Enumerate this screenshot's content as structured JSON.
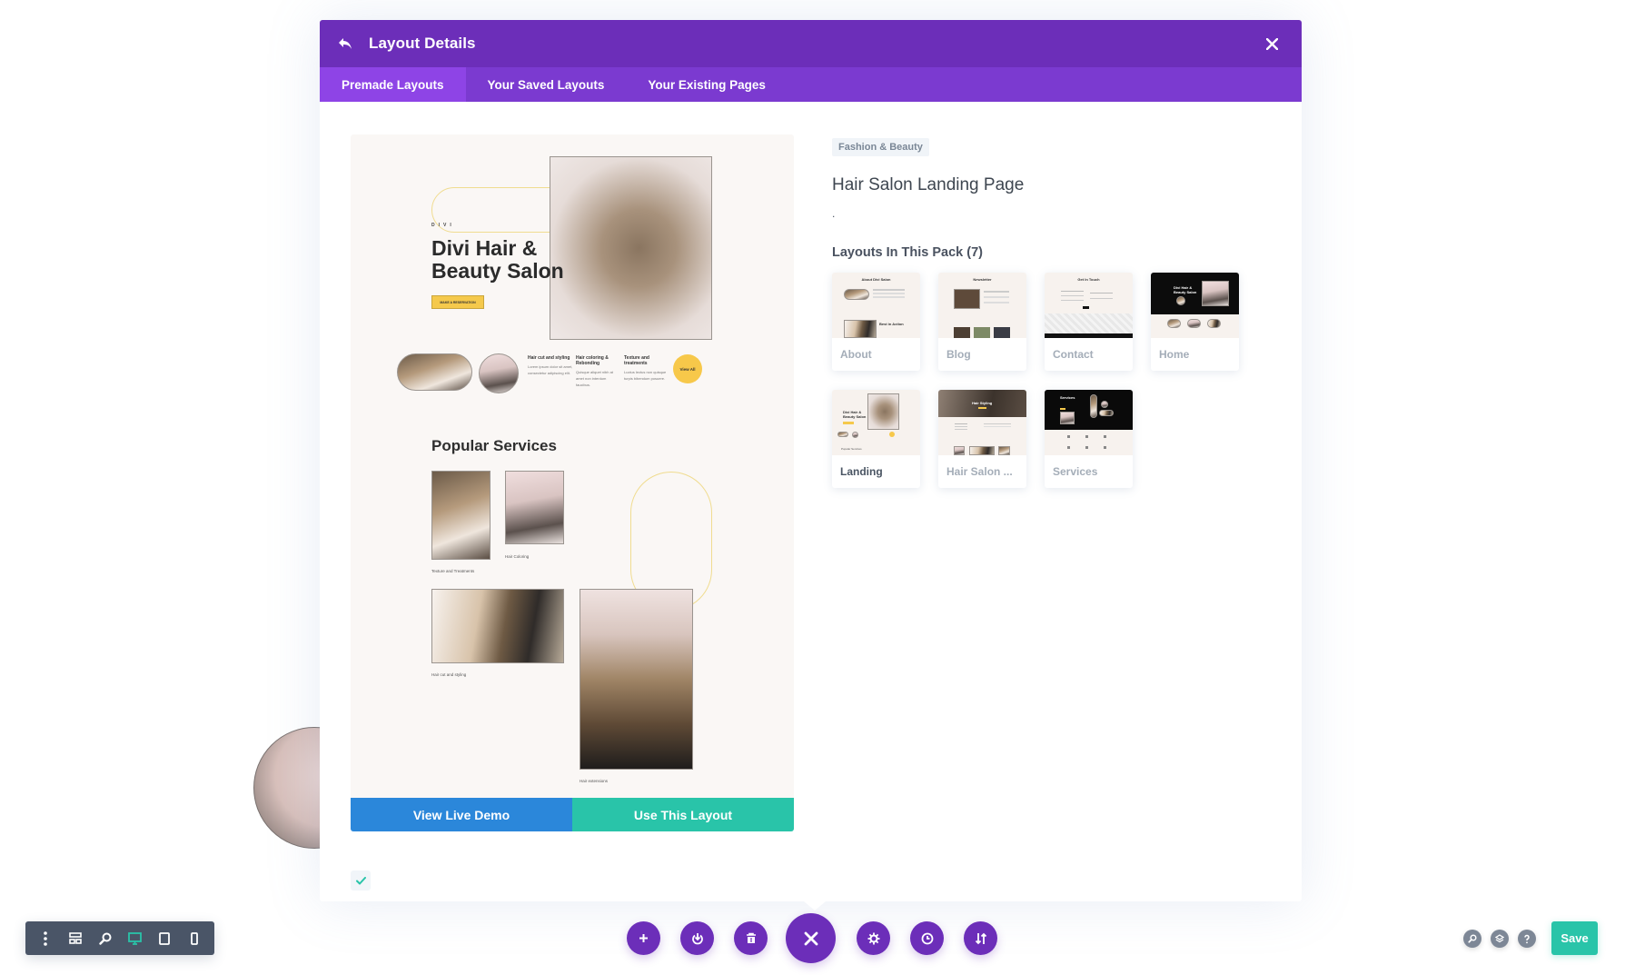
{
  "modal": {
    "title": "Layout Details",
    "back_icon": "back-arrow-icon",
    "close_icon": "close-icon"
  },
  "tabs": [
    {
      "label": "Premade Layouts",
      "active": true
    },
    {
      "label": "Your Saved Layouts",
      "active": false
    },
    {
      "label": "Your Existing Pages",
      "active": false
    }
  ],
  "preview": {
    "brand_small": "DIVI",
    "hero_title": "Divi Hair & Beauty Salon",
    "hero_button": "MAKE A RESERVATION",
    "services": [
      {
        "title": "Hair cut and styling",
        "text": "Lorem ipsum dolor sit amet, consectetur adipiscing elit."
      },
      {
        "title": "Hair coloring & Rebonding",
        "text": "Quisque aliquet nibh at amet non interdum faucibus."
      },
      {
        "title": "Texture and treatments",
        "text": "Luctus lectus non quisque turpis bibendum posuere."
      }
    ],
    "view_all": "View All",
    "popular_title": "Popular Services",
    "captions": [
      "Texture and Treatments",
      "Hair Coloring",
      "Hair cut and styling",
      "Hair extensions"
    ]
  },
  "actions": {
    "view_demo": "View Live Demo",
    "use_layout": "Use This Layout"
  },
  "details": {
    "category": "Fashion & Beauty",
    "name": "Hair Salon Landing Page",
    "description": ".",
    "pack_title": "Layouts In This Pack (7)",
    "layouts": [
      {
        "label": "About",
        "selected": false,
        "thumb_title": "About Divi Salon"
      },
      {
        "label": "Blog",
        "selected": false,
        "thumb_title": "Newsletter"
      },
      {
        "label": "Contact",
        "selected": false,
        "thumb_title": "Get In Touch"
      },
      {
        "label": "Home",
        "selected": false,
        "thumb_title": "Divi Hair & Beauty Salon"
      },
      {
        "label": "Landing",
        "selected": true,
        "thumb_title": "Divi Hair & Beauty Salon"
      },
      {
        "label": "Hair Salon ...",
        "selected": false,
        "thumb_title": "Hair Styling"
      },
      {
        "label": "Services",
        "selected": false,
        "thumb_title": "Services"
      }
    ]
  },
  "bottom_bar": {
    "left_tools": [
      "more-options",
      "wireframe",
      "zoom",
      "desktop",
      "tablet",
      "phone"
    ],
    "active_tool": "desktop",
    "center_tools": [
      "add",
      "portability",
      "clear",
      "close",
      "settings",
      "history",
      "page-settings"
    ],
    "save_label": "Save"
  },
  "colors": {
    "header": "#6c2eb9",
    "tabs": "#7b3ad0",
    "active_tab": "#8e44e6",
    "demo_button": "#2b87da",
    "use_button": "#29c4a9",
    "save_button": "#29c4a9"
  }
}
